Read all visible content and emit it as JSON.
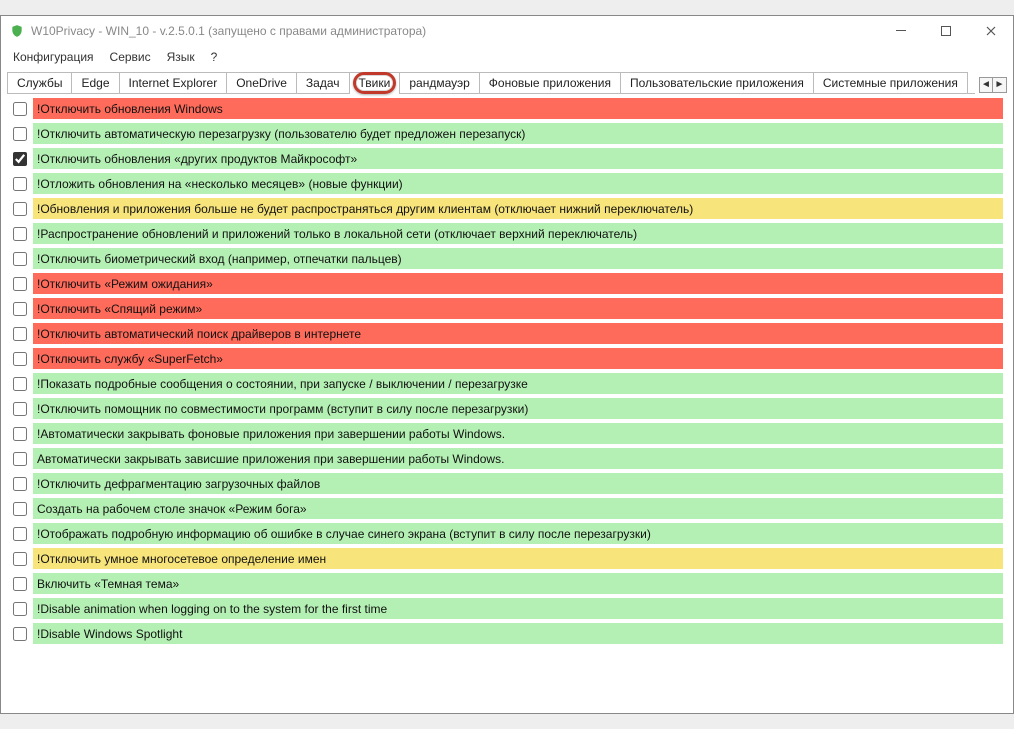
{
  "window": {
    "title": "W10Privacy - WIN_10 - v.2.5.0.1 (запущено с правами администратора)"
  },
  "menu": {
    "items": [
      "Конфигурация",
      "Сервис",
      "Язык",
      "?"
    ]
  },
  "tabs": {
    "items": [
      {
        "label": "Службы"
      },
      {
        "label": "Edge"
      },
      {
        "label": "Internet Explorer"
      },
      {
        "label": "OneDrive"
      },
      {
        "label": "Задач"
      },
      {
        "label": "Твики",
        "active": true,
        "highlight": true
      },
      {
        "label": "рандмауэр"
      },
      {
        "label": "Фоновые приложения"
      },
      {
        "label": "Пользовательские приложения"
      },
      {
        "label": "Системные приложения"
      }
    ],
    "nav_left": "◄",
    "nav_right": "►"
  },
  "rows": [
    {
      "checked": false,
      "color": "red",
      "text": "!Отключить обновления Windows"
    },
    {
      "checked": false,
      "color": "green",
      "text": "!Отключить автоматическую перезагрузку (пользователю будет предложен перезапуск)"
    },
    {
      "checked": true,
      "color": "green",
      "text": "!Отключить обновления «других продуктов Майкрософт»"
    },
    {
      "checked": false,
      "color": "green",
      "text": "!Отложить обновления на «несколько месяцев» (новые функции)"
    },
    {
      "checked": false,
      "color": "yellow",
      "text": "!Обновления и приложения больше не будет распространяться другим клиентам (отключает нижний переключатель)"
    },
    {
      "checked": false,
      "color": "green",
      "text": "!Распространение обновлений и приложений только в локальной сети (отключает верхний переключатель)"
    },
    {
      "checked": false,
      "color": "green",
      "text": "!Отключить биометрический вход (например, отпечатки пальцев)"
    },
    {
      "checked": false,
      "color": "red",
      "text": "!Отключить «Режим ожидания»"
    },
    {
      "checked": false,
      "color": "red",
      "text": "!Отключить «Спящий режим»"
    },
    {
      "checked": false,
      "color": "red",
      "text": "!Отключить автоматический поиск драйверов в интернете"
    },
    {
      "checked": false,
      "color": "red",
      "text": "!Отключить службу «SuperFetch»"
    },
    {
      "checked": false,
      "color": "green",
      "text": "!Показать подробные сообщения о состоянии, при запуске / выключении / перезагрузке"
    },
    {
      "checked": false,
      "color": "green",
      "text": "!Отключить помощник по совместимости программ (вступит в силу после перезагрузки)"
    },
    {
      "checked": false,
      "color": "green",
      "text": "!Автоматически закрывать фоновые приложения при завершении работы Windows."
    },
    {
      "checked": false,
      "color": "green",
      "text": "Автоматически закрывать зависшие приложения при завершении работы Windows."
    },
    {
      "checked": false,
      "color": "green",
      "text": "!Отключить дефрагментацию загрузочных файлов"
    },
    {
      "checked": false,
      "color": "green",
      "text": "Создать на рабочем столе значок «Режим бога»"
    },
    {
      "checked": false,
      "color": "green",
      "text": "!Отображать подробную информацию об ошибке в случае синего экрана (вступит в силу после перезагрузки)"
    },
    {
      "checked": false,
      "color": "yellow",
      "text": "!Отключить умное многосетевое определение имен"
    },
    {
      "checked": false,
      "color": "green",
      "text": "Включить «Темная тема»"
    },
    {
      "checked": false,
      "color": "green",
      "text": "!Disable animation when logging on to the system for the first time"
    },
    {
      "checked": false,
      "color": "green",
      "text": "!Disable Windows Spotlight"
    }
  ]
}
